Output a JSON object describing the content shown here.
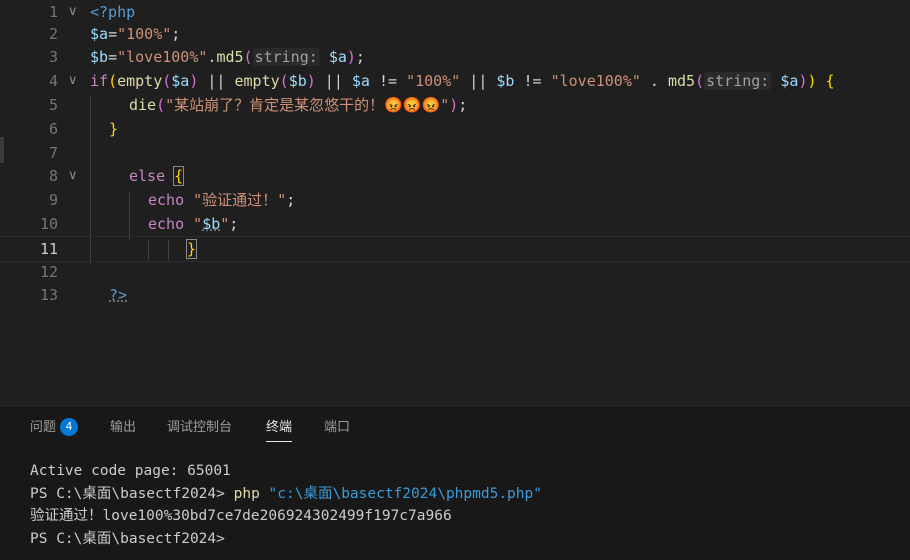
{
  "editor": {
    "line_numbers": [
      "1",
      "2",
      "3",
      "4",
      "5",
      "6",
      "7",
      "8",
      "9",
      "10",
      "11",
      "12",
      "13"
    ],
    "active_line": "11",
    "code": {
      "l1": {
        "open_tag": "<?php"
      },
      "l2": {
        "var": "$a",
        "eq": "=",
        "str": "\"100%\"",
        "semi": ";"
      },
      "l3": {
        "var": "$b",
        "eq": "=",
        "str": "\"love100%\"",
        "dot": ".",
        "fn": "md5",
        "p_open": "(",
        "hint": "string:",
        "arg": "$a",
        "p_close": ")",
        "semi": ";"
      },
      "l4": {
        "kw_if": "if",
        "p1": "(",
        "fn1": "empty",
        "p2": "(",
        "v1": "$a",
        "p3": ")",
        "or1": " || ",
        "fn2": "empty",
        "p4": "(",
        "v2": "$b",
        "p5": ")",
        "or2": " || ",
        "v3": "$a",
        "ne1": " != ",
        "s1": "\"100%\"",
        "or3": " || ",
        "v4": "$b",
        "ne2": " != ",
        "s2": "\"love100%\"",
        "dot": " . ",
        "fn3": "md5",
        "p6": "(",
        "hint": "string:",
        "v5": "$a",
        "p7": ")",
        "p8": ")",
        "brace": " {"
      },
      "l5": {
        "fn": "die",
        "p_open": "(",
        "str": "\"某站崩了？肯定是某忽悠干的！😡😡😡\"",
        "p_close": ")",
        "semi": ";"
      },
      "l6": {
        "brace": "}"
      },
      "l8": {
        "kw_else": "else",
        "brace": "{"
      },
      "l9": {
        "kw_echo": "echo",
        "str": "\"验证通过！\"",
        "semi": ";"
      },
      "l10": {
        "kw_echo": "echo",
        "q_open": "\"",
        "var": "$b",
        "q_close": "\"",
        "semi": ";"
      },
      "l11": {
        "brace": "}"
      },
      "l13": {
        "close_tag": "?>"
      }
    }
  },
  "panel": {
    "tabs": [
      {
        "label": "问题",
        "badge": "4"
      },
      {
        "label": "输出"
      },
      {
        "label": "调试控制台"
      },
      {
        "label": "终端"
      },
      {
        "label": "端口"
      }
    ],
    "active_tab": "终端",
    "terminal": {
      "line1": "Active code page: 65001",
      "line2_prompt": "PS C:\\桌面\\basectf2024> ",
      "line2_cmd": "php",
      "line2_arg": " \"c:\\桌面\\basectf2024\\phpmd5.php\"",
      "line3": "验证通过！love100%30bd7ce7de206924302499f197c7a966",
      "line4": "PS C:\\桌面\\basectf2024> "
    }
  },
  "colors": {
    "background": "#1f1f1f",
    "keyword": "#c586c0",
    "variable": "#9cdcfe",
    "string": "#ce9178",
    "function": "#dcdcaa",
    "tag": "#569cd6",
    "badge": "#0078d4"
  }
}
